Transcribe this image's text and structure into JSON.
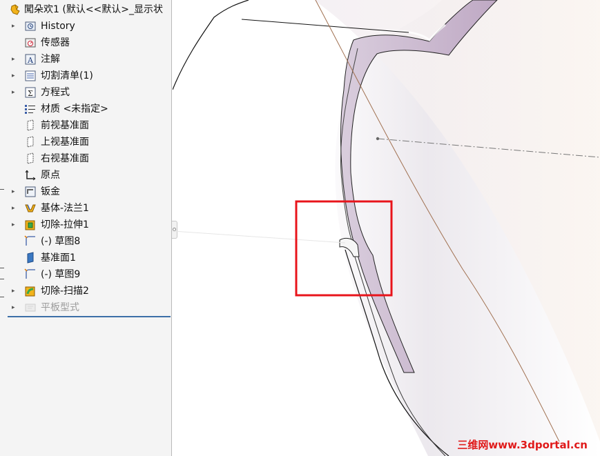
{
  "tree": {
    "root_label": "闖朵欢1 (默认<<默认>_显示状",
    "items": [
      {
        "label": "History",
        "icon": "history-icon",
        "expandable": true
      },
      {
        "label": "传感器",
        "icon": "sensor-icon",
        "expandable": false
      },
      {
        "label": "注解",
        "icon": "annotation-icon",
        "expandable": true
      },
      {
        "label": "切割清单(1)",
        "icon": "cut-list-icon",
        "expandable": true
      },
      {
        "label": "方程式",
        "icon": "equation-icon",
        "expandable": true
      },
      {
        "label": "材质 <未指定>",
        "icon": "material-icon",
        "expandable": false
      },
      {
        "label": "前视基准面",
        "icon": "plane-icon",
        "expandable": false
      },
      {
        "label": "上视基准面",
        "icon": "plane-icon",
        "expandable": false
      },
      {
        "label": "右视基准面",
        "icon": "plane-icon",
        "expandable": false
      },
      {
        "label": "原点",
        "icon": "origin-icon",
        "expandable": false
      },
      {
        "label": "钣金",
        "icon": "sheet-metal-icon",
        "expandable": true
      },
      {
        "label": "基体-法兰1",
        "icon": "base-flange-icon",
        "expandable": true
      },
      {
        "label": "切除-拉伸1",
        "icon": "cut-extrude-icon",
        "expandable": true
      },
      {
        "label": "(-) 草图8",
        "icon": "sketch-icon",
        "expandable": false
      },
      {
        "label": "基准面1",
        "icon": "plane-filled-icon",
        "expandable": false
      },
      {
        "label": "(-) 草图9",
        "icon": "sketch-icon",
        "expandable": false
      },
      {
        "label": "切除-扫描2",
        "icon": "cut-sweep-icon",
        "expandable": true
      },
      {
        "label": "平板型式",
        "icon": "flat-pattern-icon",
        "expandable": true,
        "dimmed": true
      }
    ]
  },
  "viewport": {
    "highlight_color": "#e8141b",
    "watermark": "三维网www.3dportal.cn"
  }
}
